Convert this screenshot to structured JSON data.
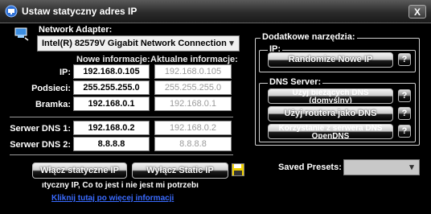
{
  "window": {
    "title": "Ustaw statyczny adres IP",
    "close_label": "X"
  },
  "adapter": {
    "label": "Network Adapter:",
    "selected": "Intel(R) 82579V Gigabit Network Connection"
  },
  "headers": {
    "new_info": "Nowe informacje:",
    "current_info": "Aktualne informacje:"
  },
  "rows": [
    {
      "label": "IP:",
      "new": "192.168.0.105",
      "current": "192.168.0.105"
    },
    {
      "label": "Podsieci:",
      "new": "255.255.255.0",
      "current": "255.255.255.0"
    },
    {
      "label": "Bramka:",
      "new": "192.168.0.1",
      "current": "192.168.0.1"
    },
    {
      "label": "Serwer DNS 1:",
      "new": "192.168.0.2",
      "current": "192.168.0.2"
    },
    {
      "label": "Serwer DNS 2:",
      "new": "8.8.8.8",
      "current": "8.8.8.8"
    }
  ],
  "buttons": {
    "enable_static": "Włącz statyczne IP",
    "disable_static": "Wyłącz Static IP"
  },
  "info_text": "ıtyczny IP, Co to jest i nie jest mi potrzebı",
  "help_link": "Kliknij tutaj po więcej informacji",
  "tools": {
    "group_label": "Dodatkowe narzędzia:",
    "ip_group": {
      "label": "IP:",
      "randomize": "Randomize Nowe IP"
    },
    "dns_group": {
      "label": "DNS Server:",
      "current_dns_l1": "Użyj bieżących DNS",
      "current_dns_l2": "(domyślny)",
      "router_dns": "Użyj routera jako DNS",
      "opendns_l1": "Korzystanie z serwera DNS",
      "opendns_l2": "OpenDNS"
    },
    "help_label": "?"
  },
  "presets": {
    "label": "Saved Presets:",
    "selected": ""
  },
  "colors": {
    "background": "#000000",
    "link": "#3a6bff",
    "readonly_text": "#9a9a9a"
  }
}
